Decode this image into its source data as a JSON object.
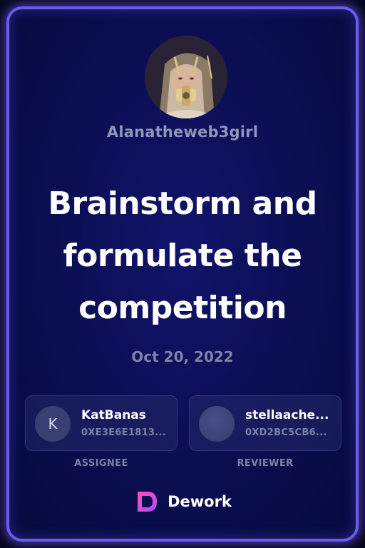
{
  "card": {
    "accent_color": "#6a5cf0",
    "background_color": "#0c0f55"
  },
  "profile": {
    "avatar": "profile-photo",
    "username": "Alanatheweb3girl"
  },
  "task": {
    "title": "Brainstorm and formulate the competition",
    "date": "Oct 20, 2022"
  },
  "assignee": {
    "initial": "K",
    "name": "KatBanas",
    "address": "0XE3E6E1813...",
    "role_label": "ASSIGNEE"
  },
  "reviewer": {
    "avatar": "avatar-placeholder",
    "name": "stellaache...",
    "address": "0XD2BC5CB6...",
    "role_label": "REVIEWER"
  },
  "brand": {
    "logo_icon": "dework-logo-icon",
    "name": "Dework"
  }
}
